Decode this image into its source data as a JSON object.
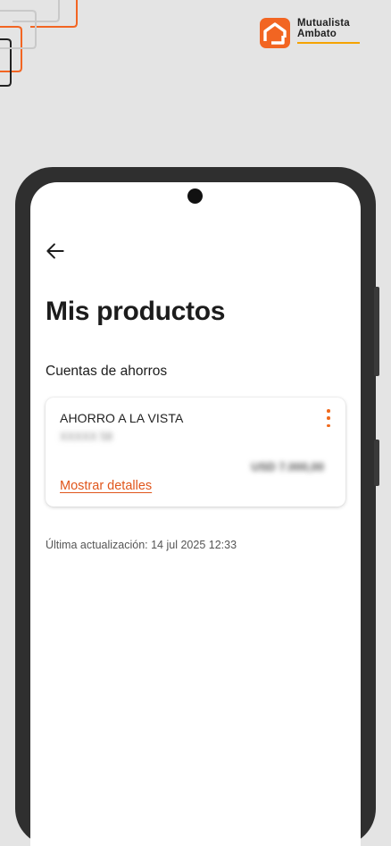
{
  "brand": {
    "line1": "Mutualista",
    "line2": "Ambato",
    "accent_color": "#F26522",
    "underline_color": "#F5A300"
  },
  "screen": {
    "back_icon": "arrow-left-icon",
    "title": "Mis productos",
    "section_title": "Cuentas de ahorros",
    "account": {
      "name": "AHORRO A LA VISTA",
      "number_masked": "XXXXX 58",
      "amount_masked": "USD 7.000,00",
      "details_link": "Mostrar detalles",
      "menu_icon": "more-vertical-icon"
    },
    "last_update": "Última actualización: 14 jul 2025 12:33"
  },
  "colors": {
    "background": "#E4E4E4",
    "accent": "#F06A1D",
    "link": "#E0561C",
    "phone_frame": "#2F2F2F"
  }
}
